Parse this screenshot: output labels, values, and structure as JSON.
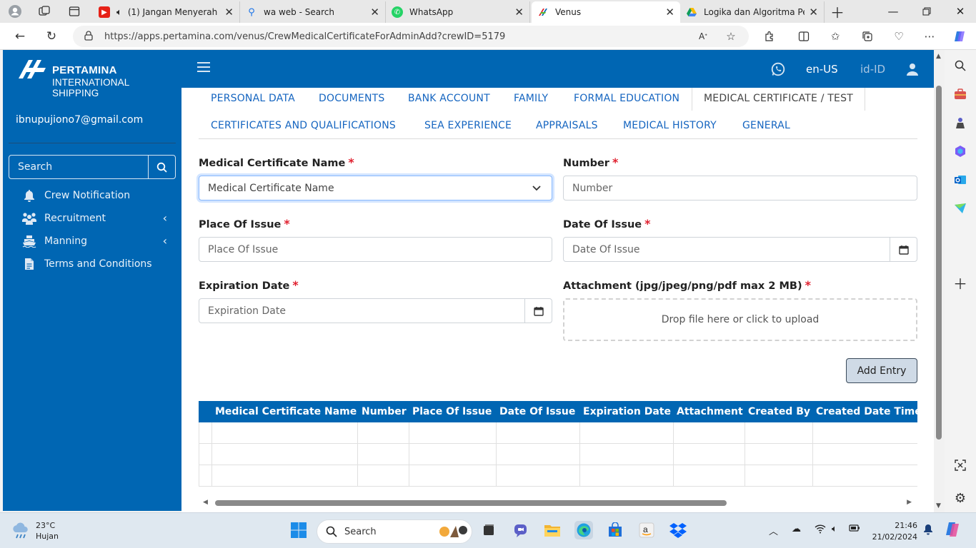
{
  "browser": {
    "tabs": [
      {
        "title": "(1) Jangan Menyerah",
        "icon": "youtube-icon"
      },
      {
        "title": "wa web - Search",
        "icon": "search-icon"
      },
      {
        "title": "WhatsApp",
        "icon": "whatsapp-icon"
      },
      {
        "title": "Venus",
        "icon": "pertamina-icon",
        "active": true
      },
      {
        "title": "Logika dan Algoritma Pem",
        "icon": "google-drive-icon"
      }
    ],
    "url": "https://apps.pertamina.com/venus/CrewMedicalCertificateForAdminAdd?crewID=5179"
  },
  "sidebar": {
    "brand_line1": "PERTAMINA",
    "brand_line2": "INTERNATIONAL SHIPPING",
    "user_email": "ibnupujiono7@gmail.com",
    "search_placeholder": "Search",
    "menu": [
      {
        "label": "Crew Notification",
        "icon": "bell-icon",
        "has_submenu": false
      },
      {
        "label": "Recruitment",
        "icon": "users-icon",
        "has_submenu": true
      },
      {
        "label": "Manning",
        "icon": "ship-icon",
        "has_submenu": true
      },
      {
        "label": "Terms and Conditions",
        "icon": "document-icon",
        "has_submenu": false
      }
    ]
  },
  "topbar": {
    "lang_en": "en-US",
    "lang_id": "id-ID"
  },
  "tabs": {
    "row1": [
      "PERSONAL DATA",
      "DOCUMENTS",
      "BANK ACCOUNT",
      "FAMILY",
      "FORMAL EDUCATION",
      "MEDICAL CERTIFICATE / TEST"
    ],
    "row2": [
      "CERTIFICATES AND QUALIFICATIONS",
      "SEA EXPERIENCE",
      "APPRAISALS",
      "MEDICAL HISTORY",
      "GENERAL"
    ],
    "active": "MEDICAL CERTIFICATE / TEST"
  },
  "form": {
    "medical_certificate_name": {
      "label": "Medical Certificate Name",
      "placeholder": "Medical Certificate Name"
    },
    "number": {
      "label": "Number",
      "placeholder": "Number"
    },
    "place_of_issue": {
      "label": "Place Of Issue",
      "placeholder": "Place Of Issue"
    },
    "date_of_issue": {
      "label": "Date Of Issue",
      "placeholder": "Date Of Issue"
    },
    "expiration_date": {
      "label": "Expiration Date",
      "placeholder": "Expiration Date"
    },
    "attachment": {
      "label": "Attachment (jpg/jpeg/png/pdf max 2 MB)",
      "dropzone_text": "Drop file here or click to upload"
    },
    "required_mark": "*",
    "add_button": "Add Entry"
  },
  "table": {
    "columns": [
      "Medical Certificate Name",
      "Number",
      "Place Of Issue",
      "Date Of Issue",
      "Expiration Date",
      "Attachment",
      "Created By",
      "Created Date Time"
    ],
    "rows": [
      [],
      [],
      []
    ]
  },
  "taskbar": {
    "weather_temp": "23°C",
    "weather_desc": "Hujan",
    "search_label": "Search",
    "time": "21:46",
    "date": "21/02/2024"
  },
  "colors": {
    "brand_blue": "#0066b3",
    "link_blue": "#1565c0",
    "required_red": "#e0202f"
  }
}
